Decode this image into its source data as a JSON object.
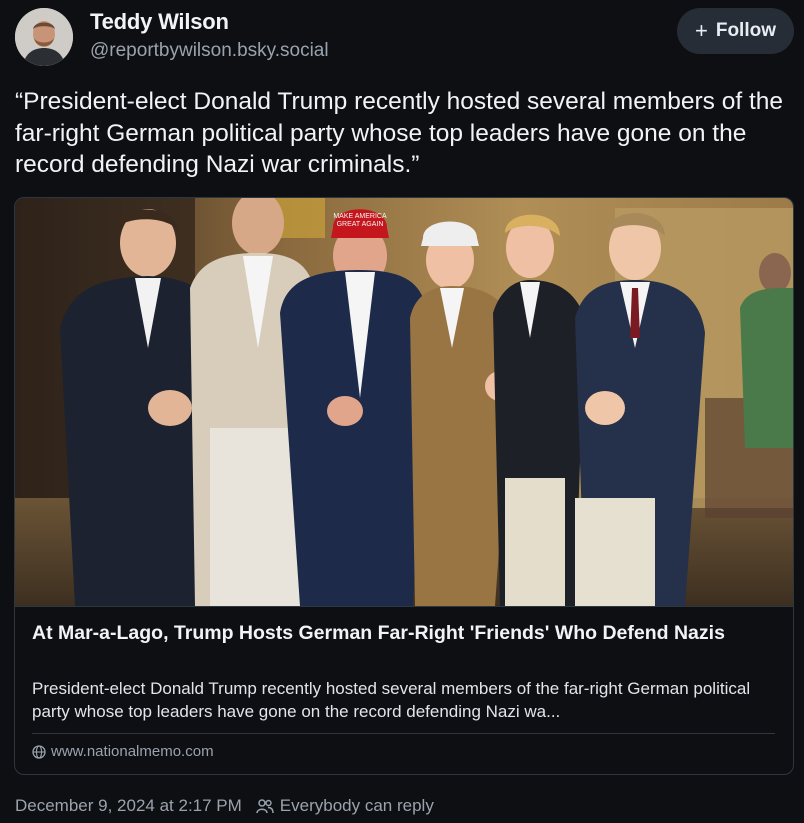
{
  "author": {
    "name": "Teddy Wilson",
    "handle": "@reportbywilson.bsky.social"
  },
  "follow_button": {
    "icon": "plus-icon",
    "label": "Follow"
  },
  "post": {
    "text": "“President-elect Donald Trump recently hosted several members of the far-right German political party whose top leaders have gone on the record defending Nazi war criminals.”"
  },
  "embed": {
    "photo_hat_text": [
      "MAKE AMERICA",
      "GREAT AGAIN"
    ],
    "title": "At Mar-a-Lago, Trump Hosts German Far-Right 'Friends' Who Defend Nazis",
    "description": "President-elect Donald Trump recently hosted several members of the far-right German political party whose top leaders have gone on the record defending Nazi wa...",
    "domain_icon": "globe-icon",
    "domain": "www.nationalmemo.com"
  },
  "footer": {
    "timestamp": "December 9, 2024 at 2:17 PM",
    "reply_icon": "people-icon",
    "reply_setting": "Everybody can reply"
  },
  "colors": {
    "background": "#0d0f13",
    "button_bg": "#262d36",
    "muted_text": "#9aa3ad",
    "border": "#2e3640",
    "hat_red": "#c4161c"
  }
}
